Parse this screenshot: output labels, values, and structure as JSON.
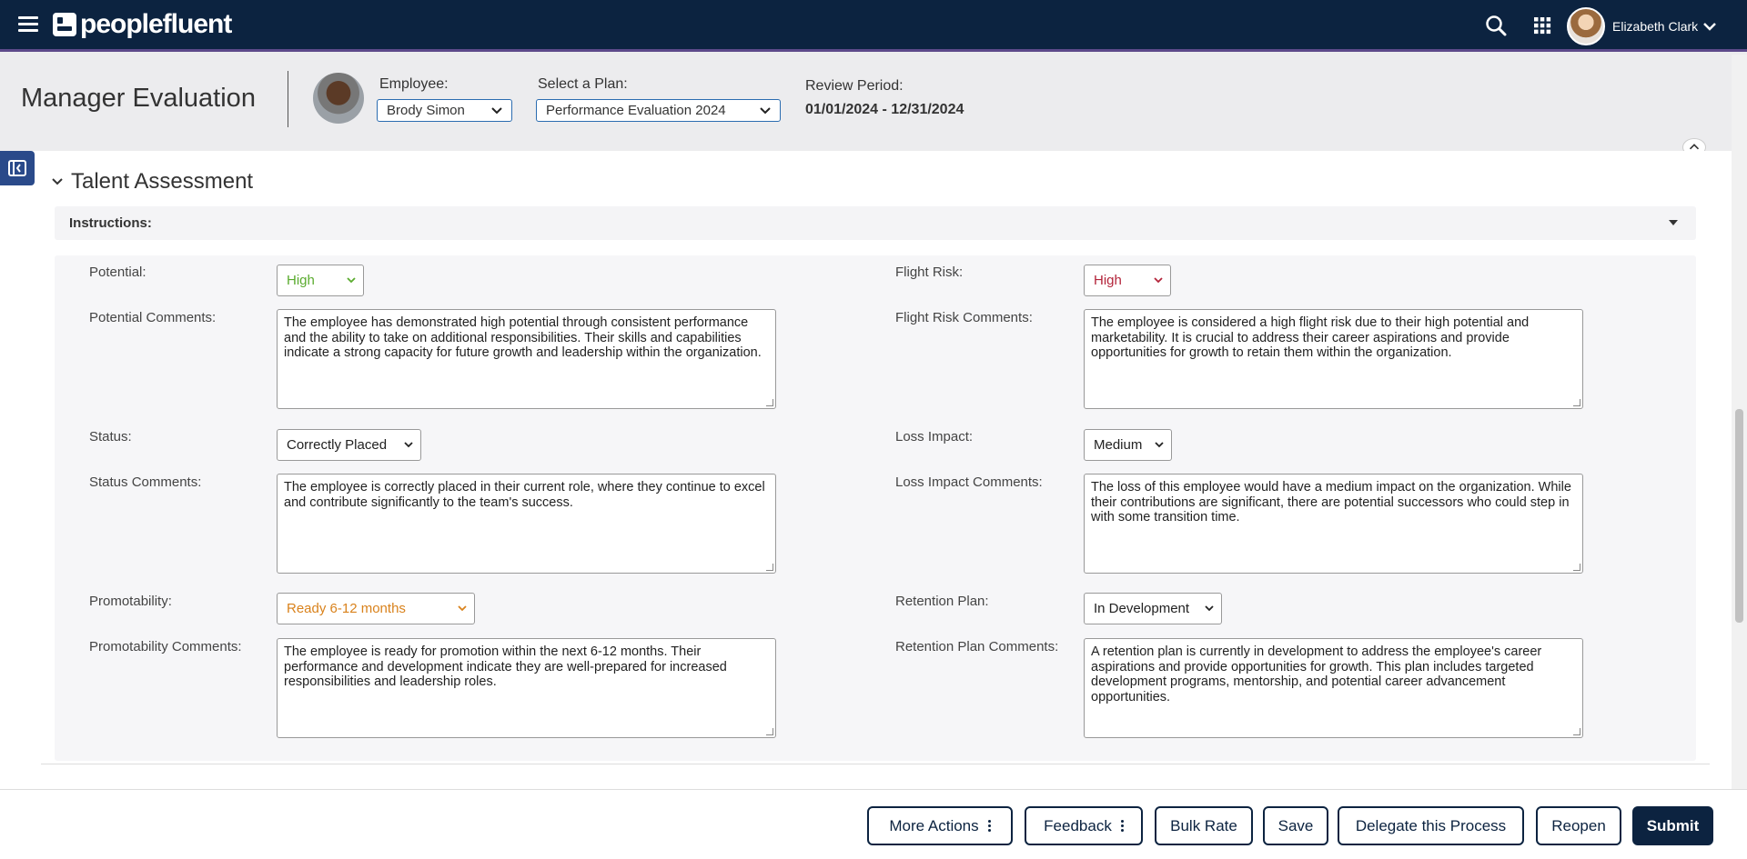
{
  "app": {
    "logo_text": "peoplefluent"
  },
  "topbar": {
    "user_name": "Elizabeth Clark"
  },
  "header": {
    "title": "Manager Evaluation",
    "employee_label": "Employee:",
    "employee_value": "Brody Simon",
    "plan_label": "Select a Plan:",
    "plan_value": "Performance Evaluation 2024",
    "review_label": "Review Period:",
    "review_value": "01/01/2024 - 12/31/2024"
  },
  "section": {
    "title": "Talent Assessment",
    "instructions_label": "Instructions:"
  },
  "form": {
    "potential": {
      "label": "Potential:",
      "value": "High",
      "color": "#5aab2e"
    },
    "potential_comments": {
      "label": "Potential Comments:",
      "value": "The employee has demonstrated high potential through consistent performance and the ability to take on additional responsibilities. Their skills and capabilities indicate a strong capacity for future growth and leadership within the organization."
    },
    "status": {
      "label": "Status:",
      "value": "Correctly Placed",
      "color": "#222222"
    },
    "status_comments": {
      "label": "Status Comments:",
      "value": "The employee is correctly placed in their current role, where they continue to excel and contribute significantly to the team's success."
    },
    "promotability": {
      "label": "Promotability:",
      "value": "Ready 6-12 months",
      "color": "#d9821c"
    },
    "promotability_comments": {
      "label": "Promotability Comments:",
      "value": "The employee is ready for promotion within the next 6-12 months. Their performance and development indicate they are well-prepared for increased responsibilities and leadership roles."
    },
    "flight_risk": {
      "label": "Flight Risk:",
      "value": "High",
      "color": "#b3243a"
    },
    "flight_risk_comments": {
      "label": "Flight Risk Comments:",
      "value": "The employee is considered a high flight risk due to their high potential and marketability. It is crucial to address their career aspirations and provide opportunities for growth to retain them within the organization."
    },
    "loss_impact": {
      "label": "Loss Impact:",
      "value": "Medium",
      "color": "#222222"
    },
    "loss_impact_comments": {
      "label": "Loss Impact Comments:",
      "value": "The loss of this employee would have a medium impact on the organization. While their contributions are significant, there are potential successors who could step in with some transition time."
    },
    "retention_plan": {
      "label": "Retention Plan:",
      "value": "In Development",
      "color": "#222222"
    },
    "retention_plan_comments": {
      "label": "Retention Plan Comments:",
      "value": "A retention plan is currently in development to address the employee's career aspirations and provide opportunities for growth. This plan includes targeted development programs, mentorship, and potential career advancement opportunities."
    }
  },
  "footer": {
    "more_actions": "More Actions",
    "feedback": "Feedback",
    "bulk_rate": "Bulk Rate",
    "save": "Save",
    "delegate": "Delegate this Process",
    "reopen": "Reopen",
    "submit": "Submit"
  },
  "icons": [
    "hamburger-icon",
    "search-icon",
    "apps-grid-icon",
    "chevron-down-icon",
    "sidebar-toggle-icon",
    "collapse-up-icon",
    "kebab-icon"
  ],
  "colors": {
    "topbar": "#0c2340",
    "accent": "#5d4a8a",
    "button": "#0c2340"
  }
}
